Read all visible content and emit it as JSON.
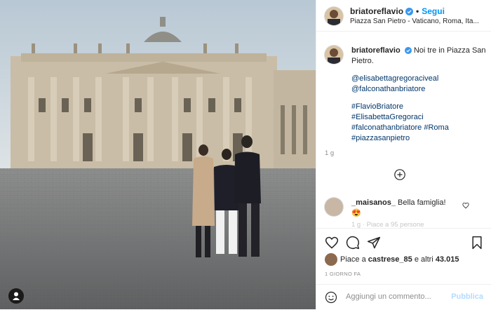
{
  "post": {
    "username": "briatoreflavio",
    "follow_label": "Segui",
    "separator": "•",
    "location": "Piazza San Pietro - Vaticano, Roma, Ita...",
    "caption_user": "briatoreflavio",
    "caption_text": "Noi tre in Piazza San Pietro.",
    "mentions": [
      "@elisabettagregoraciveal",
      "@falconathanbriatore"
    ],
    "hashtags": [
      "#FlavioBriatore",
      "#ElisabettaGregoraci",
      "#falconathanbriatore #Roma",
      "#piazzasanpietro"
    ],
    "caption_likes": "1 g",
    "comment": {
      "user": "_maisanos_",
      "text": "Bella famiglia!",
      "emoji": "😍"
    },
    "faded_text": "1 g · Piace a 95 persone",
    "likes_text": "Piace a",
    "likes_user": "castrese_85",
    "likes_rest": "e altri",
    "likes_count": "43.015",
    "date": "1 GIORNO FA",
    "add_comment_placeholder": "Aggiungi un commento...",
    "publish_label": "Pubblica"
  },
  "icons": {
    "verified": "verified-badge-icon",
    "heart": "heart-icon",
    "comment": "comment-icon",
    "share": "share-icon",
    "save": "bookmark-icon",
    "plus": "load-more-plus-icon",
    "emoji": "emoji-icon",
    "user": "user-tag-icon"
  },
  "colors": {
    "accent": "#0095f6",
    "link": "#00376b",
    "muted": "#8e8e8e",
    "publish_disabled": "#b3dbff"
  }
}
